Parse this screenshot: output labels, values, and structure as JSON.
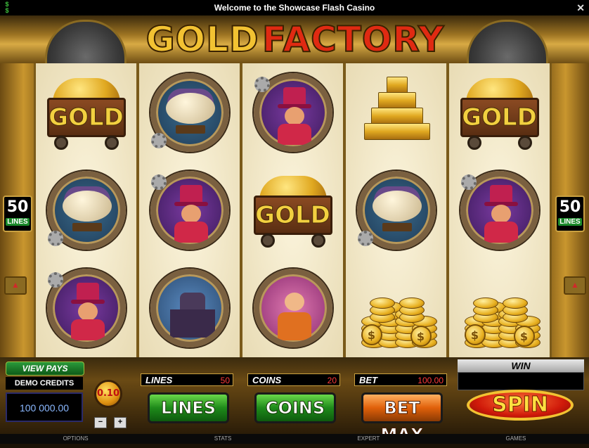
{
  "titlebar": {
    "title": "Welcome to the Showcase Flash Casino",
    "close_label": "✕"
  },
  "logo": {
    "part1": "GOLD",
    "part2": "FACTORY"
  },
  "reels": [
    [
      "gold-cart",
      "airship",
      "ringmaster"
    ],
    [
      "airship",
      "ringmaster",
      "castle"
    ],
    [
      "ringmaster",
      "gold-cart",
      "professor"
    ],
    [
      "gold-bars",
      "airship",
      "gold-coins"
    ],
    [
      "gold-cart",
      "ringmaster",
      "gold-coins"
    ]
  ],
  "symbols": {
    "gold_cart_label": "GOLD"
  },
  "side": {
    "left_lines": "50",
    "right_lines": "50",
    "lines_label": "LINES"
  },
  "panel": {
    "view_pays": "VIEW PAYS",
    "demo_credits_label": "DEMO CREDITS",
    "demo_credits_value": "100 000.00",
    "coin_size": "0.10",
    "minus": "−",
    "plus": "+",
    "lines_label": "LINES",
    "lines_value": "50",
    "coins_label": "COINS",
    "coins_value": "20",
    "bet_label": "BET",
    "bet_value": "100.00",
    "lines_button": "LINES",
    "coins_button": "COINS",
    "betmax_button": "BET MAX",
    "win_label": "WIN",
    "win_value": "",
    "spin_button": "SPIN"
  },
  "bottombar": [
    "OPTIONS",
    "STATS",
    "EXPERT",
    "GAMES"
  ]
}
